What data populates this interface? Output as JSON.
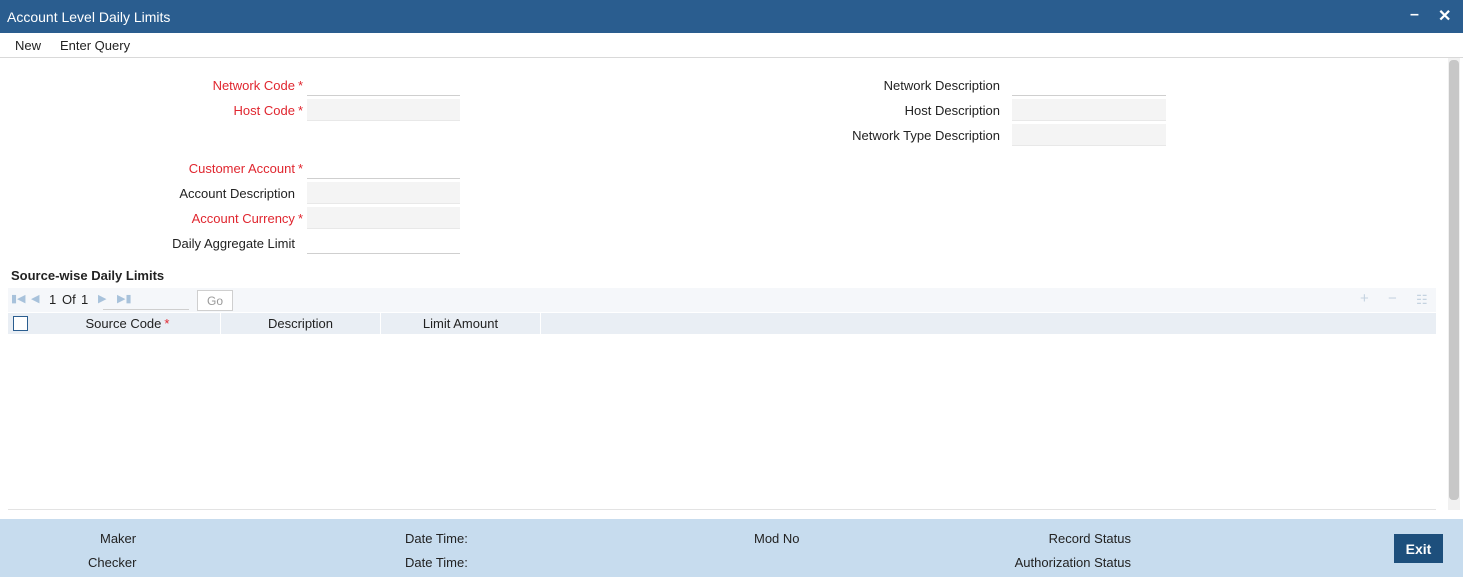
{
  "window": {
    "title": "Account Level Daily Limits",
    "minimize_glyph": "–",
    "close_glyph": "✕"
  },
  "menu": {
    "new": "New",
    "enter_query": "Enter Query"
  },
  "form": {
    "network_code": {
      "label": "Network Code",
      "required": "*",
      "value": ""
    },
    "host_code": {
      "label": "Host Code",
      "required": "*",
      "value": ""
    },
    "customer_account": {
      "label": "Customer Account",
      "required": "*",
      "value": ""
    },
    "account_description": {
      "label": "Account Description",
      "value": ""
    },
    "account_currency": {
      "label": "Account Currency",
      "required": "*",
      "value": ""
    },
    "daily_aggregate_limit": {
      "label": "Daily Aggregate Limit",
      "value": ""
    },
    "network_description": {
      "label": "Network Description",
      "value": ""
    },
    "host_description": {
      "label": "Host Description",
      "value": ""
    },
    "network_type_description": {
      "label": "Network Type Description",
      "value": ""
    }
  },
  "grid": {
    "title": "Source-wise Daily Limits",
    "pager": {
      "current": "1",
      "of_label": "Of",
      "total": "1",
      "go_label": "Go"
    },
    "columns": [
      {
        "label": "Source Code",
        "required": "*"
      },
      {
        "label": "Description"
      },
      {
        "label": "Limit Amount"
      }
    ],
    "rows": []
  },
  "footer": {
    "maker": "Maker",
    "checker": "Checker",
    "date_time_1": "Date Time:",
    "date_time_2": "Date Time:",
    "mod_no": "Mod No",
    "record_status": "Record Status",
    "authorization_status": "Authorization Status",
    "exit": "Exit"
  },
  "colors": {
    "titlebar": "#2a5d8f",
    "required": "#e0262f",
    "footer": "#c7dcee",
    "exit_button": "#1d4f7c"
  }
}
